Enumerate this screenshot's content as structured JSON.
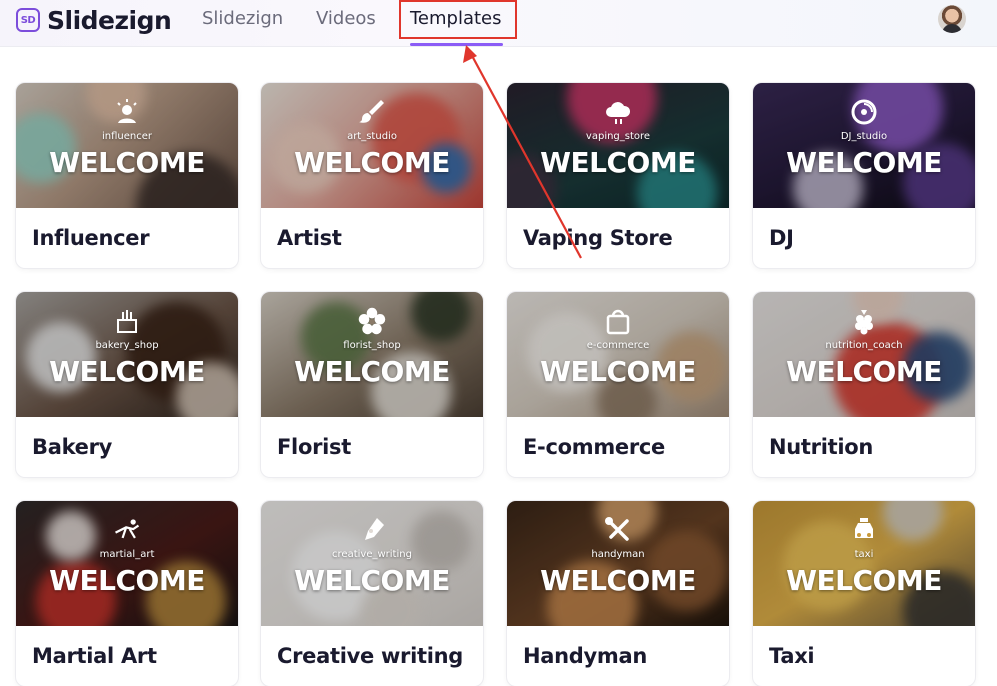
{
  "brand": {
    "logo_mark": "SD",
    "name": "Slidezign"
  },
  "nav": {
    "items": [
      {
        "label": "Slidezign"
      },
      {
        "label": "Videos"
      },
      {
        "label": "Templates"
      }
    ],
    "active": "Templates"
  },
  "colors": {
    "accent": "#8b5cf6",
    "brand": "#7c4ddb",
    "annotation": "#e0362c",
    "text": "#1a1a2e"
  },
  "templates": [
    {
      "title": "Influencer",
      "slug": "influencer",
      "banner": "WELCOME",
      "icon": "influencer-icon"
    },
    {
      "title": "Artist",
      "slug": "art_studio",
      "banner": "WELCOME",
      "icon": "paintbrush-icon"
    },
    {
      "title": "Vaping Store",
      "slug": "vaping_store",
      "banner": "WELCOME",
      "icon": "cloud-icon"
    },
    {
      "title": "DJ",
      "slug": "DJ_studio",
      "banner": "WELCOME",
      "icon": "vinyl-icon"
    },
    {
      "title": "Bakery",
      "slug": "bakery_shop",
      "banner": "WELCOME",
      "icon": "cake-icon"
    },
    {
      "title": "Florist",
      "slug": "florist_shop",
      "banner": "WELCOME",
      "icon": "flower-icon"
    },
    {
      "title": "E-commerce",
      "slug": "e-commerce",
      "banner": "WELCOME",
      "icon": "shopping-bag-icon"
    },
    {
      "title": "Nutrition",
      "slug": "nutrition_coach",
      "banner": "WELCOME",
      "icon": "raspberry-icon"
    },
    {
      "title": "Martial Art",
      "slug": "martial_art",
      "banner": "WELCOME",
      "icon": "martial-artist-icon"
    },
    {
      "title": "Creative writing",
      "slug": "creative_writing",
      "banner": "WELCOME",
      "icon": "fountain-pen-icon"
    },
    {
      "title": "Handyman",
      "slug": "handyman",
      "banner": "WELCOME",
      "icon": "tools-icon"
    },
    {
      "title": "Taxi",
      "slug": "taxi",
      "banner": "WELCOME",
      "icon": "taxi-icon"
    }
  ]
}
